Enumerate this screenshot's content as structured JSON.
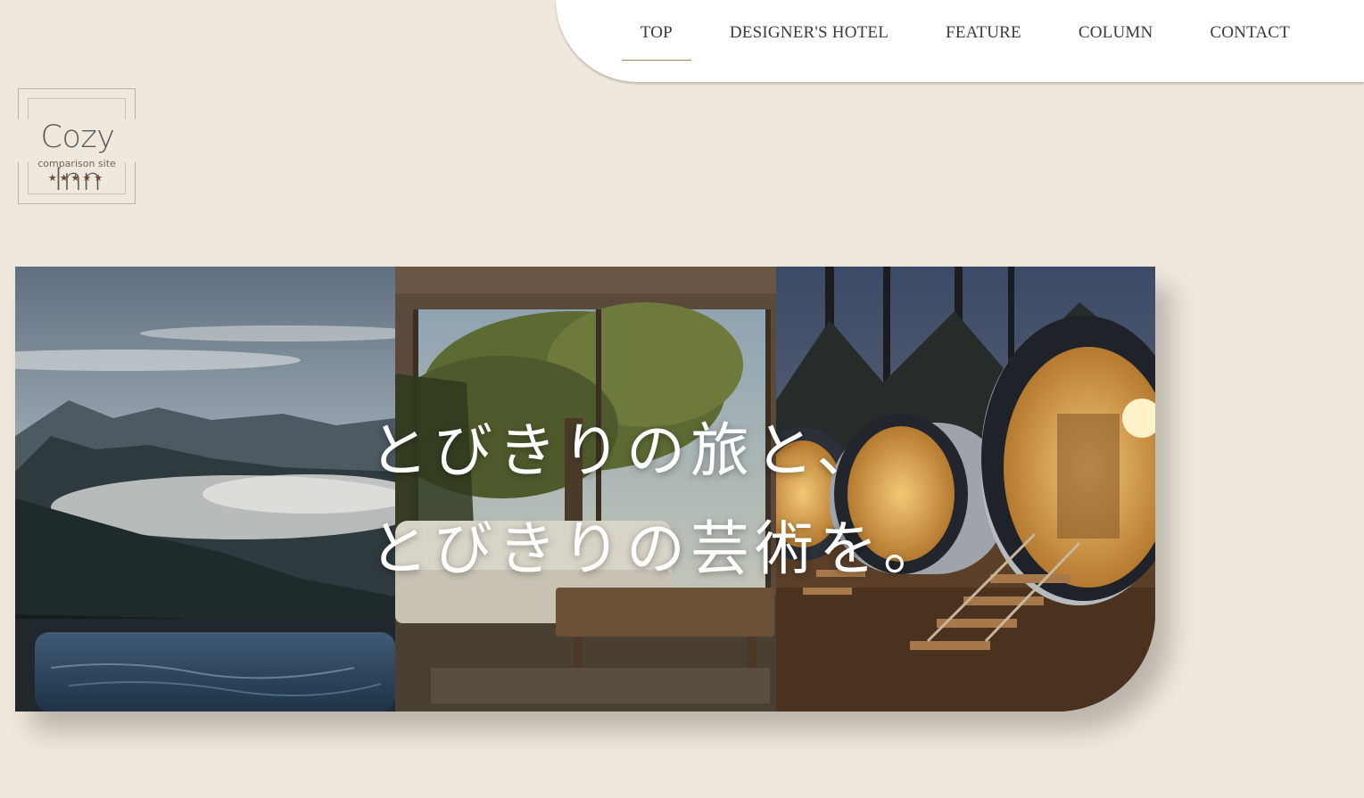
{
  "nav": {
    "items": [
      {
        "label": "TOP",
        "active": true
      },
      {
        "label": "DESIGNER'S HOTEL",
        "active": false
      },
      {
        "label": "FEATURE",
        "active": false
      },
      {
        "label": "COLUMN",
        "active": false
      },
      {
        "label": "CONTACT",
        "active": false
      }
    ]
  },
  "logo": {
    "title": "Cozy Inn",
    "subtitle": "comparison site",
    "stars": "★★★★★"
  },
  "hero": {
    "line1": "とびきりの旅と、",
    "line2": "とびきりの芸術を。",
    "images": [
      "misty-mountain-hot-tub",
      "modern-living-room-forest-view",
      "capsule-cabins-forest-night"
    ]
  },
  "colors": {
    "background": "#efe8dd",
    "nav_underline": "#b58552",
    "star": "#6b4a2e"
  }
}
